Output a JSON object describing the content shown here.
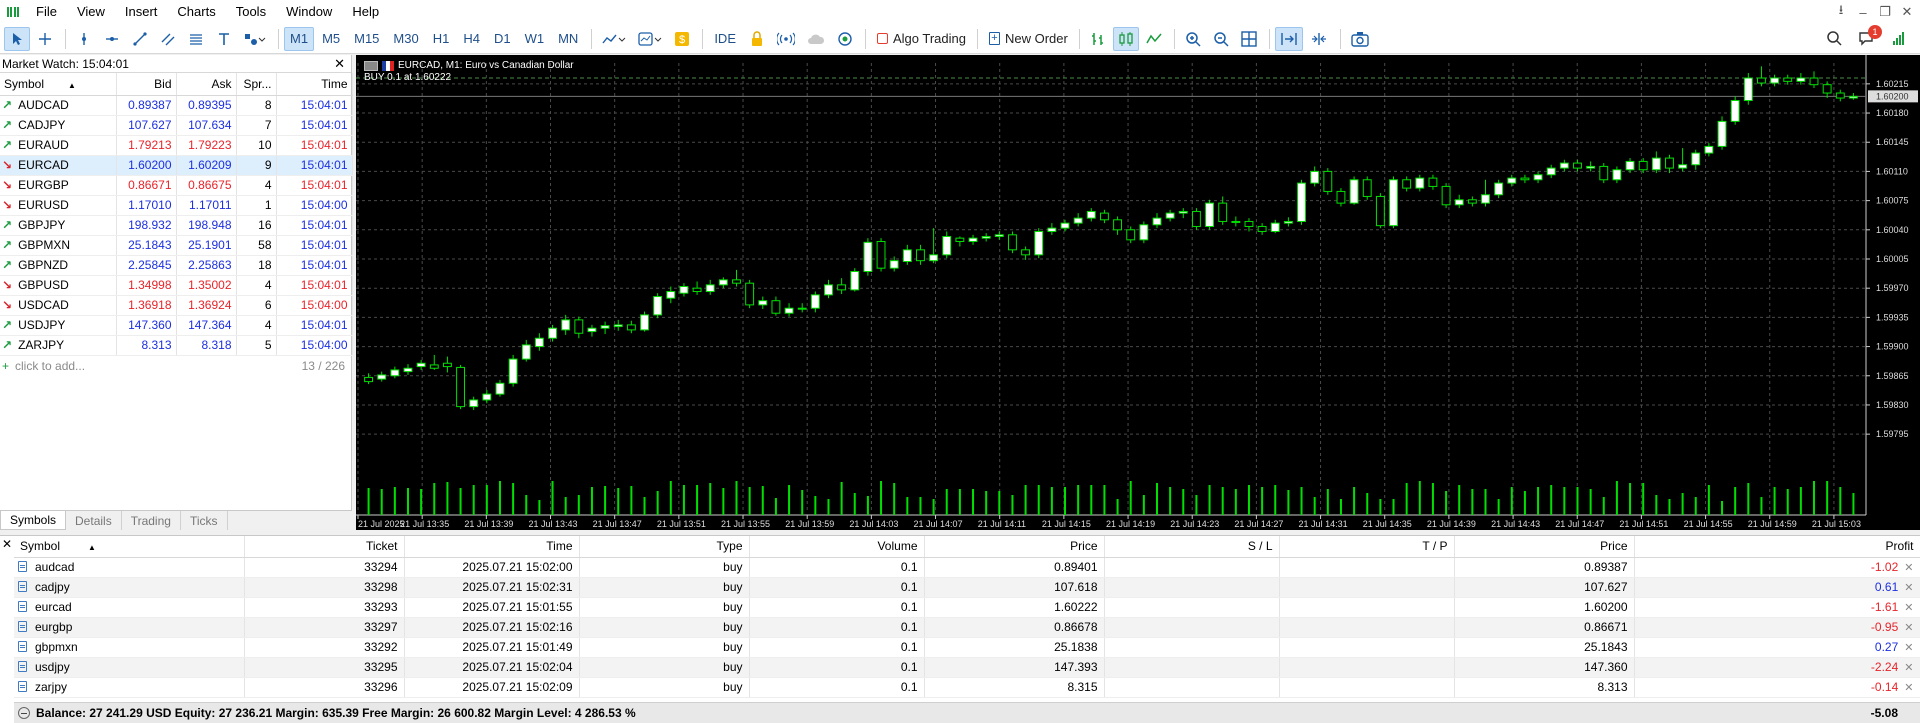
{
  "menu": {
    "items": [
      "File",
      "View",
      "Insert",
      "Charts",
      "Tools",
      "Window",
      "Help"
    ]
  },
  "toolbar": {
    "timeframes": [
      "M1",
      "M5",
      "M15",
      "M30",
      "H1",
      "H4",
      "D1",
      "W1",
      "MN"
    ],
    "active_timeframe": "M1",
    "ide_label": "IDE",
    "algo_trading_label": "Algo Trading",
    "new_order_label": "New Order",
    "notification_count": "1"
  },
  "market_watch": {
    "title": "Market Watch: 15:04:01",
    "columns": [
      "Symbol",
      "Bid",
      "Ask",
      "Spr...",
      "Time"
    ],
    "rows": [
      {
        "symbol": "AUDCAD",
        "dir": "up",
        "bid": "0.89387",
        "ask": "0.89395",
        "spread": "8",
        "time": "15:04:01",
        "color": "blue"
      },
      {
        "symbol": "CADJPY",
        "dir": "up",
        "bid": "107.627",
        "ask": "107.634",
        "spread": "7",
        "time": "15:04:01",
        "color": "blue"
      },
      {
        "symbol": "EURAUD",
        "dir": "up",
        "bid": "1.79213",
        "ask": "1.79223",
        "spread": "10",
        "time": "15:04:01",
        "color": "red"
      },
      {
        "symbol": "EURCAD",
        "dir": "down",
        "bid": "1.60200",
        "ask": "1.60209",
        "spread": "9",
        "time": "15:04:01",
        "color": "blue",
        "selected": true
      },
      {
        "symbol": "EURGBP",
        "dir": "down",
        "bid": "0.86671",
        "ask": "0.86675",
        "spread": "4",
        "time": "15:04:01",
        "color": "red"
      },
      {
        "symbol": "EURUSD",
        "dir": "down",
        "bid": "1.17010",
        "ask": "1.17011",
        "spread": "1",
        "time": "15:04:00",
        "color": "blue"
      },
      {
        "symbol": "GBPJPY",
        "dir": "up",
        "bid": "198.932",
        "ask": "198.948",
        "spread": "16",
        "time": "15:04:01",
        "color": "blue"
      },
      {
        "symbol": "GBPMXN",
        "dir": "up",
        "bid": "25.1843",
        "ask": "25.1901",
        "spread": "58",
        "time": "15:04:01",
        "color": "blue"
      },
      {
        "symbol": "GBPNZD",
        "dir": "up",
        "bid": "2.25845",
        "ask": "2.25863",
        "spread": "18",
        "time": "15:04:01",
        "color": "blue"
      },
      {
        "symbol": "GBPUSD",
        "dir": "down",
        "bid": "1.34998",
        "ask": "1.35002",
        "spread": "4",
        "time": "15:04:01",
        "color": "red"
      },
      {
        "symbol": "USDCAD",
        "dir": "down",
        "bid": "1.36918",
        "ask": "1.36924",
        "spread": "6",
        "time": "15:04:00",
        "color": "red"
      },
      {
        "symbol": "USDJPY",
        "dir": "up",
        "bid": "147.360",
        "ask": "147.364",
        "spread": "4",
        "time": "15:04:01",
        "color": "blue"
      },
      {
        "symbol": "ZARJPY",
        "dir": "up",
        "bid": "8.313",
        "ask": "8.318",
        "spread": "5",
        "time": "15:04:00",
        "color": "blue"
      }
    ],
    "add_label": "click to add...",
    "count": "13 / 226",
    "tabs": [
      "Symbols",
      "Details",
      "Trading",
      "Ticks"
    ],
    "active_tab": "Symbols"
  },
  "chart": {
    "symbol_title": "EURCAD, M1:  Euro vs Canadian Dollar",
    "order_label": "BUY 0.1 at 1.60222",
    "current_price": "1.60200",
    "price_labels": [
      "1.60215",
      "1.60180",
      "1.60145",
      "1.60110",
      "1.60075",
      "1.60040",
      "1.60005",
      "1.59970",
      "1.59935",
      "1.59900",
      "1.59865",
      "1.59830",
      "1.59795"
    ],
    "time_labels": [
      "21 Jul 2025",
      "21 Jul 13:35",
      "21 Jul 13:39",
      "21 Jul 13:43",
      "21 Jul 13:47",
      "21 Jul 13:51",
      "21 Jul 13:55",
      "21 Jul 13:59",
      "21 Jul 14:03",
      "21 Jul 14:07",
      "21 Jul 14:11",
      "21 Jul 14:15",
      "21 Jul 14:19",
      "21 Jul 14:23",
      "21 Jul 14:27",
      "21 Jul 14:31",
      "21 Jul 14:35",
      "21 Jul 14:39",
      "21 Jul 14:43",
      "21 Jul 14:47",
      "21 Jul 14:51",
      "21 Jul 14:55",
      "21 Jul 14:59",
      "21 Jul 15:03"
    ],
    "y_min": 1.5977,
    "y_max": 1.6024,
    "order_price": 1.60222,
    "bid_price": 1.602,
    "candles": [
      [
        1.59863,
        1.59858,
        1.59868,
        1.59855
      ],
      [
        1.59861,
        1.59866,
        1.5987,
        1.59858
      ],
      [
        1.59865,
        1.59872,
        1.59876,
        1.59862
      ],
      [
        1.5987,
        1.59874,
        1.59879,
        1.59866
      ],
      [
        1.59876,
        1.5988,
        1.59884,
        1.59872
      ],
      [
        1.59878,
        1.59874,
        1.5989,
        1.59872
      ],
      [
        1.5988,
        1.59876,
        1.59888,
        1.59869
      ],
      [
        1.59875,
        1.59828,
        1.59878,
        1.59825
      ],
      [
        1.59828,
        1.59836,
        1.5984,
        1.59824
      ],
      [
        1.59836,
        1.59843,
        1.59848,
        1.59832
      ],
      [
        1.59843,
        1.59856,
        1.5986,
        1.5984
      ],
      [
        1.59856,
        1.59885,
        1.5989,
        1.59852
      ],
      [
        1.59885,
        1.59902,
        1.59908,
        1.59882
      ],
      [
        1.599,
        1.5991,
        1.59916,
        1.59895
      ],
      [
        1.5991,
        1.59922,
        1.59926,
        1.59906
      ],
      [
        1.5992,
        1.59932,
        1.59938,
        1.59914
      ],
      [
        1.59932,
        1.59916,
        1.59936,
        1.5991
      ],
      [
        1.59918,
        1.59922,
        1.59926,
        1.59912
      ],
      [
        1.59922,
        1.59925,
        1.5993,
        1.59915
      ],
      [
        1.59924,
        1.59926,
        1.59932,
        1.59919
      ],
      [
        1.59926,
        1.5992,
        1.59931,
        1.59916
      ],
      [
        1.5992,
        1.59938,
        1.59942,
        1.59918
      ],
      [
        1.59938,
        1.5996,
        1.59964,
        1.59934
      ],
      [
        1.59958,
        1.59966,
        1.59972,
        1.59952
      ],
      [
        1.59964,
        1.59972,
        1.59976,
        1.5996
      ],
      [
        1.5997,
        1.59966,
        1.59978,
        1.59962
      ],
      [
        1.59966,
        1.59974,
        1.5998,
        1.59962
      ],
      [
        1.59974,
        1.5998,
        1.59983,
        1.5997
      ],
      [
        1.5998,
        1.59976,
        1.59992,
        1.59972
      ],
      [
        1.59976,
        1.5995,
        1.5998,
        1.59946
      ],
      [
        1.5995,
        1.59955,
        1.5996,
        1.59945
      ],
      [
        1.59955,
        1.5994,
        1.5996,
        1.59937
      ],
      [
        1.5994,
        1.59946,
        1.59952,
        1.59936
      ],
      [
        1.59946,
        1.59946,
        1.59952,
        1.59941
      ],
      [
        1.59946,
        1.59962,
        1.59966,
        1.59941
      ],
      [
        1.59962,
        1.59974,
        1.5998,
        1.59958
      ],
      [
        1.59974,
        1.59968,
        1.59982,
        1.59963
      ],
      [
        1.59968,
        1.5999,
        1.59994,
        1.59966
      ],
      [
        1.5999,
        1.60025,
        1.6003,
        1.59985
      ],
      [
        1.60026,
        1.59994,
        1.6003,
        1.5999
      ],
      [
        1.59994,
        1.60003,
        1.60008,
        1.5999
      ],
      [
        1.60002,
        1.60016,
        1.60022,
        1.59998
      ],
      [
        1.60016,
        1.60003,
        1.60022,
        1.59998
      ],
      [
        1.60003,
        1.6001,
        1.60042,
        1.6
      ],
      [
        1.6001,
        1.60032,
        1.60038,
        1.60006
      ],
      [
        1.6003,
        1.60026,
        1.60032,
        1.6002
      ],
      [
        1.60026,
        1.6003,
        1.60034,
        1.60022
      ],
      [
        1.6003,
        1.60032,
        1.60036,
        1.60026
      ],
      [
        1.60032,
        1.60034,
        1.60038,
        1.60028
      ],
      [
        1.60034,
        1.60016,
        1.60038,
        1.60012
      ],
      [
        1.60016,
        1.6001,
        1.6002,
        1.60004
      ],
      [
        1.6001,
        1.60038,
        1.60042,
        1.60006
      ],
      [
        1.60038,
        1.60042,
        1.60048,
        1.60034
      ],
      [
        1.60042,
        1.60048,
        1.60052,
        1.60038
      ],
      [
        1.60048,
        1.60054,
        1.6006,
        1.60044
      ],
      [
        1.60054,
        1.60062,
        1.60066,
        1.6005
      ],
      [
        1.6006,
        1.60052,
        1.60064,
        1.60048
      ],
      [
        1.60052,
        1.6004,
        1.60056,
        1.60034
      ],
      [
        1.6004,
        1.60028,
        1.60044,
        1.60024
      ],
      [
        1.60028,
        1.60046,
        1.6005,
        1.60024
      ],
      [
        1.60046,
        1.60054,
        1.6006,
        1.60042
      ],
      [
        1.60054,
        1.6006,
        1.60064,
        1.6005
      ],
      [
        1.6006,
        1.60062,
        1.60066,
        1.60054
      ],
      [
        1.60062,
        1.60044,
        1.60066,
        1.6004
      ],
      [
        1.60044,
        1.60072,
        1.60076,
        1.6004
      ],
      [
        1.60072,
        1.6005,
        1.6008,
        1.60046
      ],
      [
        1.6005,
        1.6005,
        1.60056,
        1.60044
      ],
      [
        1.6005,
        1.60044,
        1.60054,
        1.60038
      ],
      [
        1.60044,
        1.60038,
        1.60048,
        1.60034
      ],
      [
        1.60038,
        1.60048,
        1.60052,
        1.60036
      ],
      [
        1.60048,
        1.6005,
        1.60055,
        1.60044
      ],
      [
        1.6005,
        1.60096,
        1.601,
        1.60046
      ],
      [
        1.60096,
        1.6011,
        1.60116,
        1.60092
      ],
      [
        1.6011,
        1.60086,
        1.60114,
        1.60082
      ],
      [
        1.60086,
        1.60072,
        1.6009,
        1.60068
      ],
      [
        1.60072,
        1.601,
        1.60104,
        1.6007
      ],
      [
        1.601,
        1.6008,
        1.60104,
        1.60076
      ],
      [
        1.6008,
        1.60045,
        1.60084,
        1.60042
      ],
      [
        1.60045,
        1.601,
        1.60104,
        1.60042
      ],
      [
        1.601,
        1.6009,
        1.60104,
        1.60086
      ],
      [
        1.6009,
        1.60102,
        1.60106,
        1.60086
      ],
      [
        1.60102,
        1.60092,
        1.60106,
        1.60088
      ],
      [
        1.60092,
        1.6007,
        1.60096,
        1.60066
      ],
      [
        1.6007,
        1.60076,
        1.60082,
        1.60066
      ],
      [
        1.60076,
        1.60072,
        1.6008,
        1.60068
      ],
      [
        1.60072,
        1.60082,
        1.601,
        1.60068
      ],
      [
        1.60082,
        1.60096,
        1.601,
        1.60078
      ],
      [
        1.60096,
        1.60102,
        1.60106,
        1.60092
      ],
      [
        1.60102,
        1.601,
        1.60106,
        1.60096
      ],
      [
        1.601,
        1.60106,
        1.6011,
        1.60096
      ],
      [
        1.60106,
        1.60114,
        1.60118,
        1.60102
      ],
      [
        1.60114,
        1.6012,
        1.60124,
        1.6011
      ],
      [
        1.6012,
        1.60114,
        1.60124,
        1.6011
      ],
      [
        1.60114,
        1.60116,
        1.60122,
        1.6011
      ],
      [
        1.60116,
        1.601,
        1.6012,
        1.60096
      ],
      [
        1.601,
        1.60112,
        1.60116,
        1.60096
      ],
      [
        1.60112,
        1.60122,
        1.60126,
        1.60108
      ],
      [
        1.60122,
        1.60112,
        1.60126,
        1.60108
      ],
      [
        1.60112,
        1.60126,
        1.60134,
        1.60108
      ],
      [
        1.60126,
        1.60114,
        1.6013,
        1.60108
      ],
      [
        1.60114,
        1.60118,
        1.60138,
        1.6011
      ],
      [
        1.60118,
        1.60132,
        1.60136,
        1.60112
      ],
      [
        1.60132,
        1.6014,
        1.60144,
        1.60128
      ],
      [
        1.6014,
        1.6017,
        1.60176,
        1.60136
      ],
      [
        1.6017,
        1.60195,
        1.602,
        1.60166
      ],
      [
        1.60195,
        1.60222,
        1.60228,
        1.6019
      ],
      [
        1.60222,
        1.60216,
        1.60236,
        1.60212
      ],
      [
        1.60216,
        1.60222,
        1.60226,
        1.60212
      ],
      [
        1.60222,
        1.60218,
        1.60226,
        1.60214
      ],
      [
        1.60218,
        1.60222,
        1.60228,
        1.60214
      ],
      [
        1.60222,
        1.60214,
        1.6023,
        1.6021
      ],
      [
        1.60214,
        1.60204,
        1.60218,
        1.60198
      ],
      [
        1.60204,
        1.60198,
        1.60208,
        1.60194
      ],
      [
        1.60198,
        1.602,
        1.60204,
        1.60196
      ]
    ]
  },
  "trade": {
    "columns": [
      "Symbol",
      "Ticket",
      "Time",
      "Type",
      "Volume",
      "Price",
      "S / L",
      "T / P",
      "Price",
      "Profit"
    ],
    "rows": [
      {
        "symbol": "audcad",
        "ticket": "33294",
        "time": "2025.07.21 15:02:00",
        "type": "buy",
        "volume": "0.1",
        "open_price": "0.89401",
        "sl": "",
        "tp": "",
        "price": "0.89387",
        "profit": "-1.02"
      },
      {
        "symbol": "cadjpy",
        "ticket": "33298",
        "time": "2025.07.21 15:02:31",
        "type": "buy",
        "volume": "0.1",
        "open_price": "107.618",
        "sl": "",
        "tp": "",
        "price": "107.627",
        "profit": "0.61"
      },
      {
        "symbol": "eurcad",
        "ticket": "33293",
        "time": "2025.07.21 15:01:55",
        "type": "buy",
        "volume": "0.1",
        "open_price": "1.60222",
        "sl": "",
        "tp": "",
        "price": "1.60200",
        "profit": "-1.61"
      },
      {
        "symbol": "eurgbp",
        "ticket": "33297",
        "time": "2025.07.21 15:02:16",
        "type": "buy",
        "volume": "0.1",
        "open_price": "0.86678",
        "sl": "",
        "tp": "",
        "price": "0.86671",
        "profit": "-0.95"
      },
      {
        "symbol": "gbpmxn",
        "ticket": "33292",
        "time": "2025.07.21 15:01:49",
        "type": "buy",
        "volume": "0.1",
        "open_price": "25.1838",
        "sl": "",
        "tp": "",
        "price": "25.1843",
        "profit": "0.27"
      },
      {
        "symbol": "usdjpy",
        "ticket": "33295",
        "time": "2025.07.21 15:02:04",
        "type": "buy",
        "volume": "0.1",
        "open_price": "147.393",
        "sl": "",
        "tp": "",
        "price": "147.360",
        "profit": "-2.24"
      },
      {
        "symbol": "zarjpy",
        "ticket": "33296",
        "time": "2025.07.21 15:02:09",
        "type": "buy",
        "volume": "0.1",
        "open_price": "8.315",
        "sl": "",
        "tp": "",
        "price": "8.313",
        "profit": "-0.14"
      }
    ],
    "balance_line": "Balance: 27 241.29 USD  Equity: 27 236.21  Margin: 635.39  Free Margin: 26 600.82  Margin Level: 4 286.53 %",
    "total_profit": "-5.08"
  },
  "colors": {
    "bull_candle": "#ffffff",
    "bear_candle": "#000000",
    "candle_outline": "#00e000",
    "volume": "#00e000",
    "grid": "#4a4a4a",
    "profit_negative": "#e8242a",
    "profit_positive": "#1c2fe0"
  }
}
